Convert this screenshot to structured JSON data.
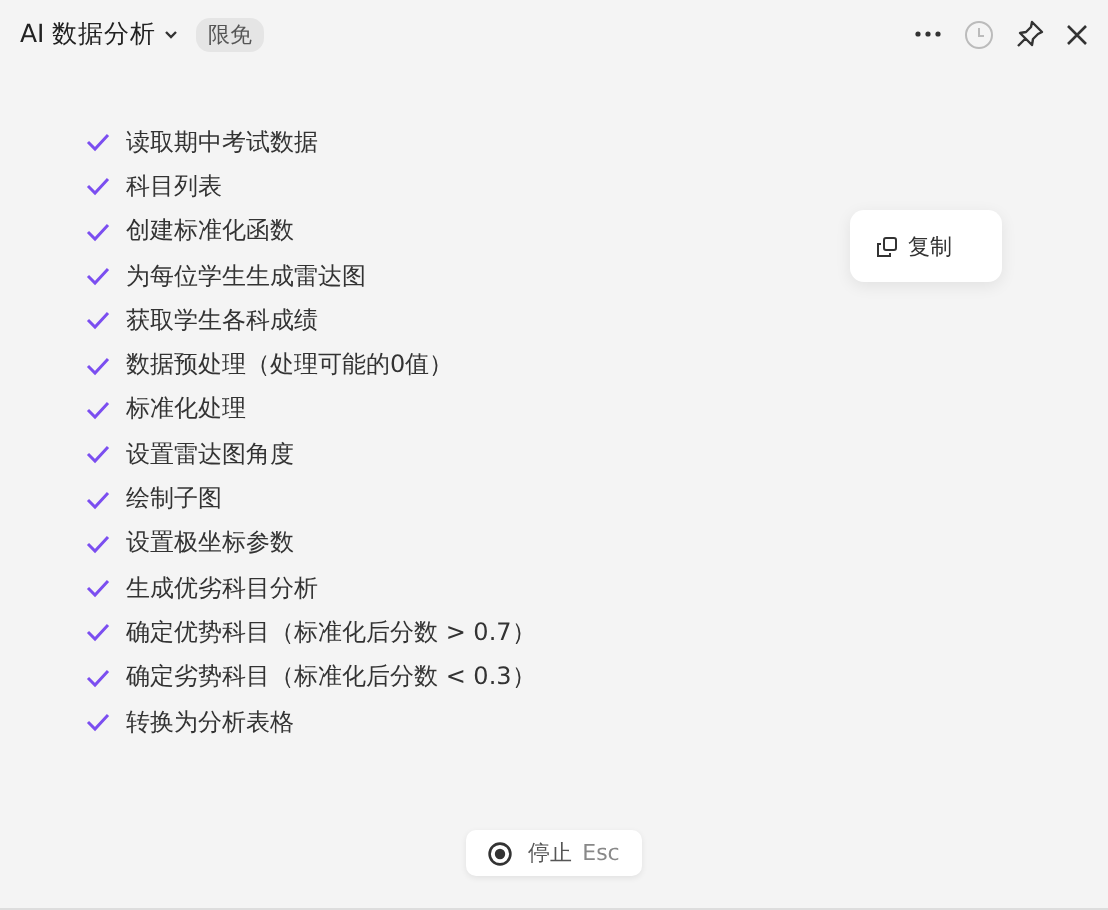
{
  "header": {
    "title": "AI 数据分析",
    "badge": "限免"
  },
  "steps": [
    {
      "label": "读取期中考试数据",
      "checked": true
    },
    {
      "label": "科目列表",
      "checked": true
    },
    {
      "label": "创建标准化函数",
      "checked": true
    },
    {
      "label": "为每位学生生成雷达图",
      "checked": true
    },
    {
      "label": "获取学生各科成绩",
      "checked": true
    },
    {
      "label": "数据预处理（处理可能的0值）",
      "checked": true
    },
    {
      "label": "标准化处理",
      "checked": true
    },
    {
      "label": "设置雷达图角度",
      "checked": true
    },
    {
      "label": "绘制子图",
      "checked": true
    },
    {
      "label": "设置极坐标参数",
      "checked": true
    },
    {
      "label": "生成优劣科目分析",
      "checked": true
    },
    {
      "label": "确定优势科目（标准化后分数 > 0.7）",
      "checked": true
    },
    {
      "label": "确定劣势科目（标准化后分数 < 0.3）",
      "checked": true
    },
    {
      "label": "转换为分析表格",
      "checked": true
    }
  ],
  "context_menu": {
    "items": [
      "复制"
    ]
  },
  "stop_button": {
    "label": "停止",
    "shortcut": "Esc"
  }
}
